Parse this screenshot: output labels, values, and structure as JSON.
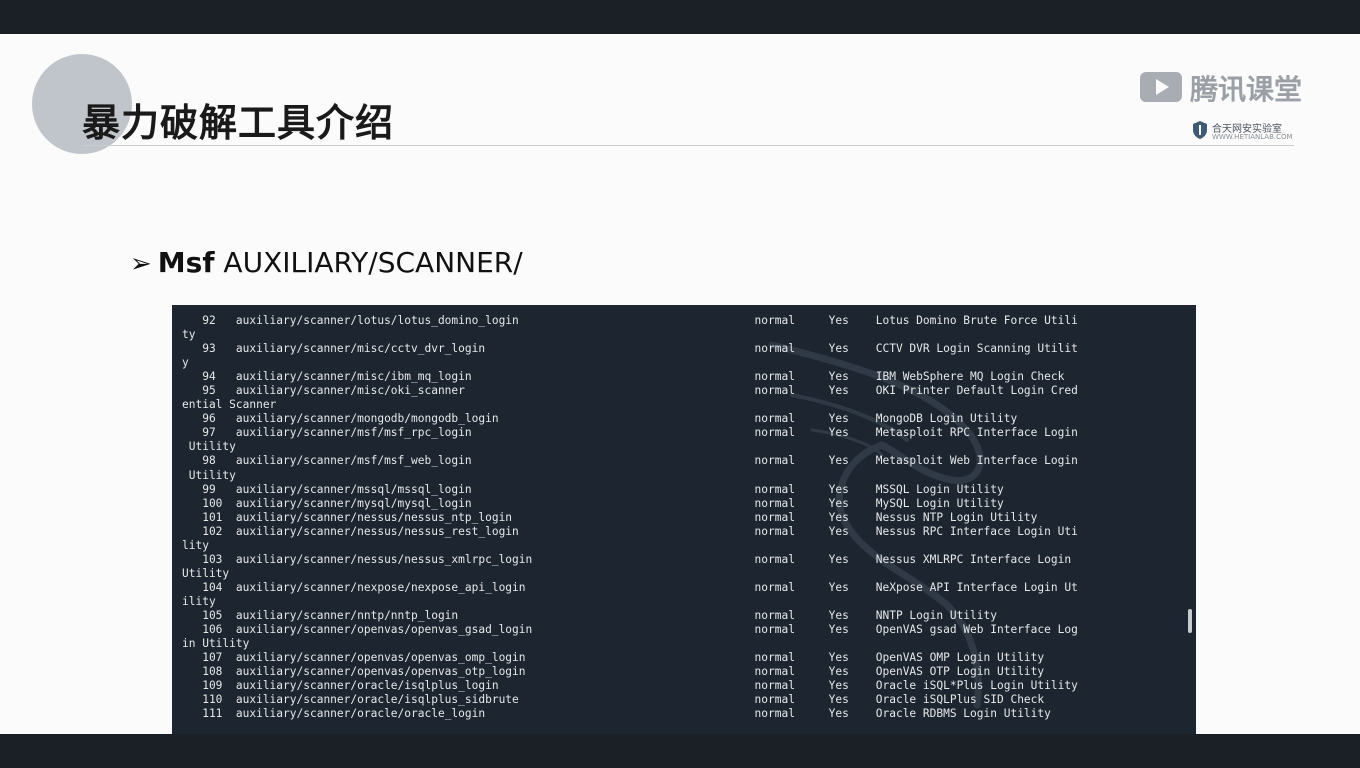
{
  "slide": {
    "title": "暴力破解工具介绍",
    "logo": {
      "brand": "腾讯课堂",
      "lab_name": "合天网安实验室",
      "lab_url": "WWW.HETIANLAB.COM"
    },
    "bullet": {
      "arrow": "➢",
      "prefix": "Msf",
      "path": "AUXILIARY/SCANNER/"
    }
  },
  "terminal": {
    "lines": [
      "   92   auxiliary/scanner/lotus/lotus_domino_login                                   normal     Yes    Lotus Domino Brute Force Utili",
      "ty",
      "   93   auxiliary/scanner/misc/cctv_dvr_login                                        normal     Yes    CCTV DVR Login Scanning Utilit",
      "y",
      "   94   auxiliary/scanner/misc/ibm_mq_login                                          normal     Yes    IBM WebSphere MQ Login Check",
      "   95   auxiliary/scanner/misc/oki_scanner                                           normal     Yes    OKI Printer Default Login Cred",
      "ential Scanner",
      "   96   auxiliary/scanner/mongodb/mongodb_login                                      normal     Yes    MongoDB Login Utility",
      "   97   auxiliary/scanner/msf/msf_rpc_login                                          normal     Yes    Metasploit RPC Interface Login",
      " Utility",
      "   98   auxiliary/scanner/msf/msf_web_login                                          normal     Yes    Metasploit Web Interface Login",
      " Utility",
      "   99   auxiliary/scanner/mssql/mssql_login                                          normal     Yes    MSSQL Login Utility",
      "   100  auxiliary/scanner/mysql/mysql_login                                          normal     Yes    MySQL Login Utility",
      "   101  auxiliary/scanner/nessus/nessus_ntp_login                                    normal     Yes    Nessus NTP Login Utility",
      "   102  auxiliary/scanner/nessus/nessus_rest_login                                   normal     Yes    Nessus RPC Interface Login Uti",
      "lity",
      "   103  auxiliary/scanner/nessus/nessus_xmlrpc_login                                 normal     Yes    Nessus XMLRPC Interface Login",
      "Utility",
      "   104  auxiliary/scanner/nexpose/nexpose_api_login                                  normal     Yes    NeXpose API Interface Login Ut",
      "ility",
      "   105  auxiliary/scanner/nntp/nntp_login                                            normal     Yes    NNTP Login Utility",
      "   106  auxiliary/scanner/openvas/openvas_gsad_login                                 normal     Yes    OpenVAS gsad Web Interface Log",
      "in Utility",
      "   107  auxiliary/scanner/openvas/openvas_omp_login                                  normal     Yes    OpenVAS OMP Login Utility",
      "   108  auxiliary/scanner/openvas/openvas_otp_login                                  normal     Yes    OpenVAS OTP Login Utility",
      "   109  auxiliary/scanner/oracle/isqlplus_login                                      normal     Yes    Oracle iSQL*Plus Login Utility",
      "   110  auxiliary/scanner/oracle/isqlplus_sidbrute                                   normal     Yes    Oracle iSQLPlus SID Check",
      "   111  auxiliary/scanner/oracle/oracle_login                                        normal     Yes    Oracle RDBMS Login Utility"
    ]
  },
  "colors": {
    "terminal_bg": "#1d2630",
    "terminal_text": "#e6e8ea",
    "slide_bg": "#fbfbfb",
    "frame_bg": "#1b2027"
  }
}
